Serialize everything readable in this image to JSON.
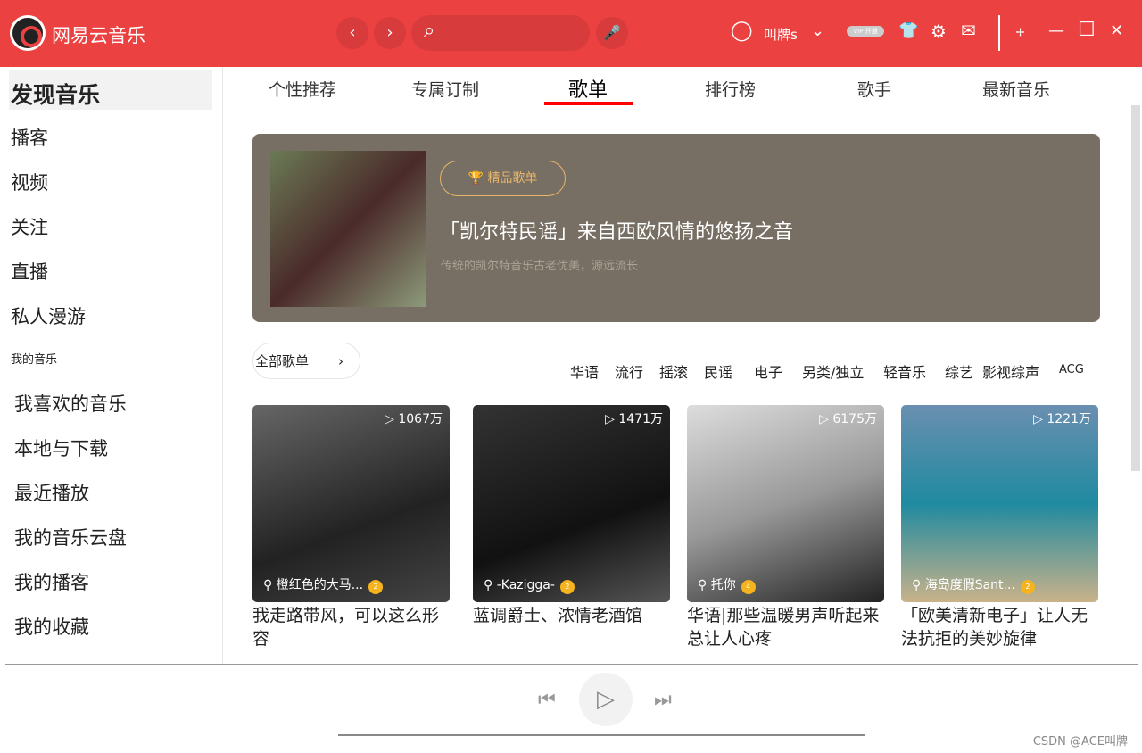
{
  "app": {
    "name": "网易云音乐",
    "username": "叫牌s",
    "vip": "VIP 开通"
  },
  "icons": {
    "back": "‹",
    "forward": "›",
    "search": "⌕",
    "mic": "🎤",
    "user": "◯",
    "dropdown": "⌄",
    "skin": "👕",
    "settings": "⚙",
    "mail": "✉",
    "mini": "⧾",
    "minimize": "—",
    "maximize": "☐",
    "close": "✕"
  },
  "sidebar": {
    "header": "发现音乐",
    "items": [
      "播客",
      "视频",
      "关注",
      "直播",
      "私人漫游"
    ],
    "section": "我的音乐",
    "my_items": [
      "我喜欢的音乐",
      "本地与下载",
      "最近播放",
      "我的音乐云盘",
      "我的播客",
      "我的收藏"
    ]
  },
  "tabs": [
    "个性推荐",
    "专属订制",
    "歌单",
    "排行榜",
    "歌手",
    "最新音乐"
  ],
  "active_tab": "歌单",
  "banner": {
    "badge": "精品歌单",
    "title": "「凯尔特民谣」来自西欧风情的悠扬之音",
    "subtitle": "传统的凯尔特音乐古老优美，源远流长"
  },
  "filter": {
    "all": "全部歌单",
    "categories": [
      "华语",
      "流行",
      "摇滚",
      "民谣",
      "电子",
      "另类/独立",
      "轻音乐",
      "综艺",
      "影视综声",
      "ACG"
    ]
  },
  "playlists": [
    {
      "count": "1067万",
      "creator": "橙红色的大马...",
      "level": "2",
      "title": "我走路带风，可以这么形容"
    },
    {
      "count": "1471万",
      "creator": "-Kazigga-",
      "level": "2",
      "title": "蓝调爵士、浓情老酒馆"
    },
    {
      "count": "6175万",
      "creator": "托你",
      "level": "4",
      "title": "华语|那些温暖男声听起来总让人心疼"
    },
    {
      "count": "1221万",
      "creator": "海岛度假Sant...",
      "level": "2",
      "title": "「欧美清新电子」让人无法抗拒的美妙旋律"
    }
  ],
  "player": {
    "prev": "⏮",
    "play": "▷",
    "next": "⏭"
  },
  "watermark": "CSDN @ACE叫牌",
  "colors": {
    "brand": "#ec4141",
    "banner": "#776f63",
    "tab_underline": "#ff0000"
  }
}
